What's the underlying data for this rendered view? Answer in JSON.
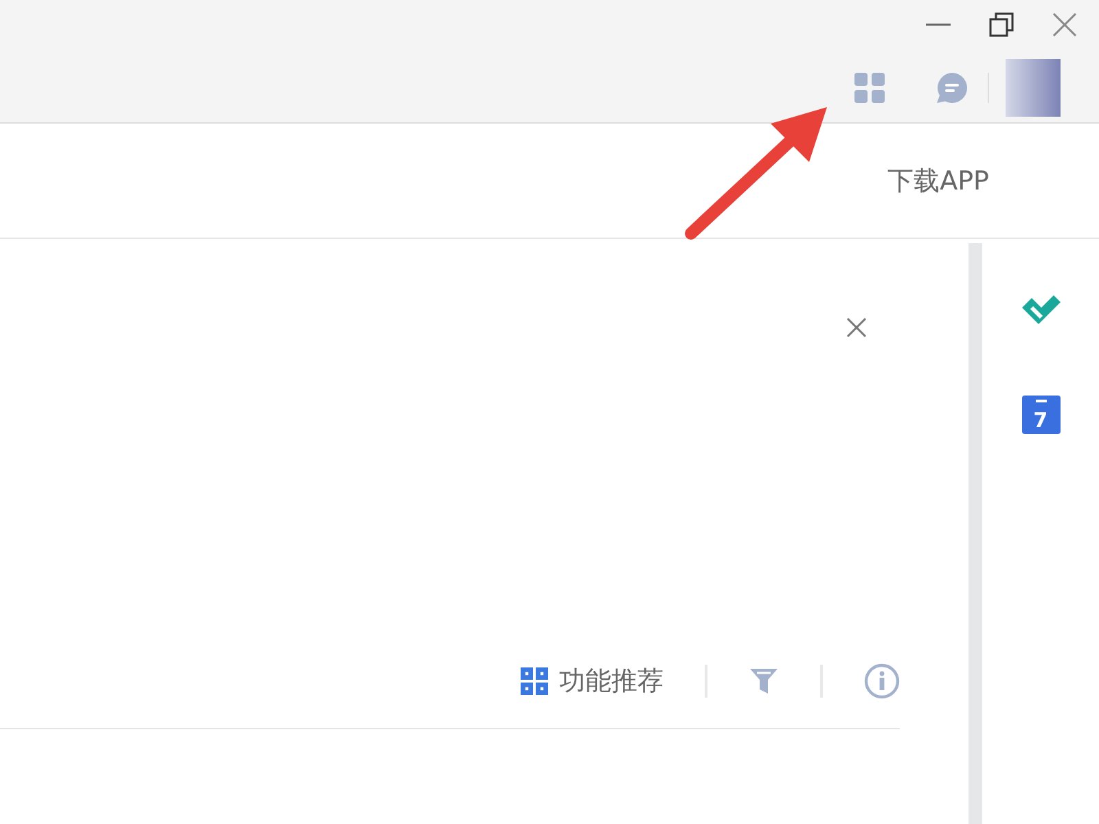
{
  "header": {
    "download_link": "下载APP"
  },
  "toolbar": {
    "recommend_button": "功能推荐"
  },
  "sidebar": {
    "calendar_day": "7"
  }
}
